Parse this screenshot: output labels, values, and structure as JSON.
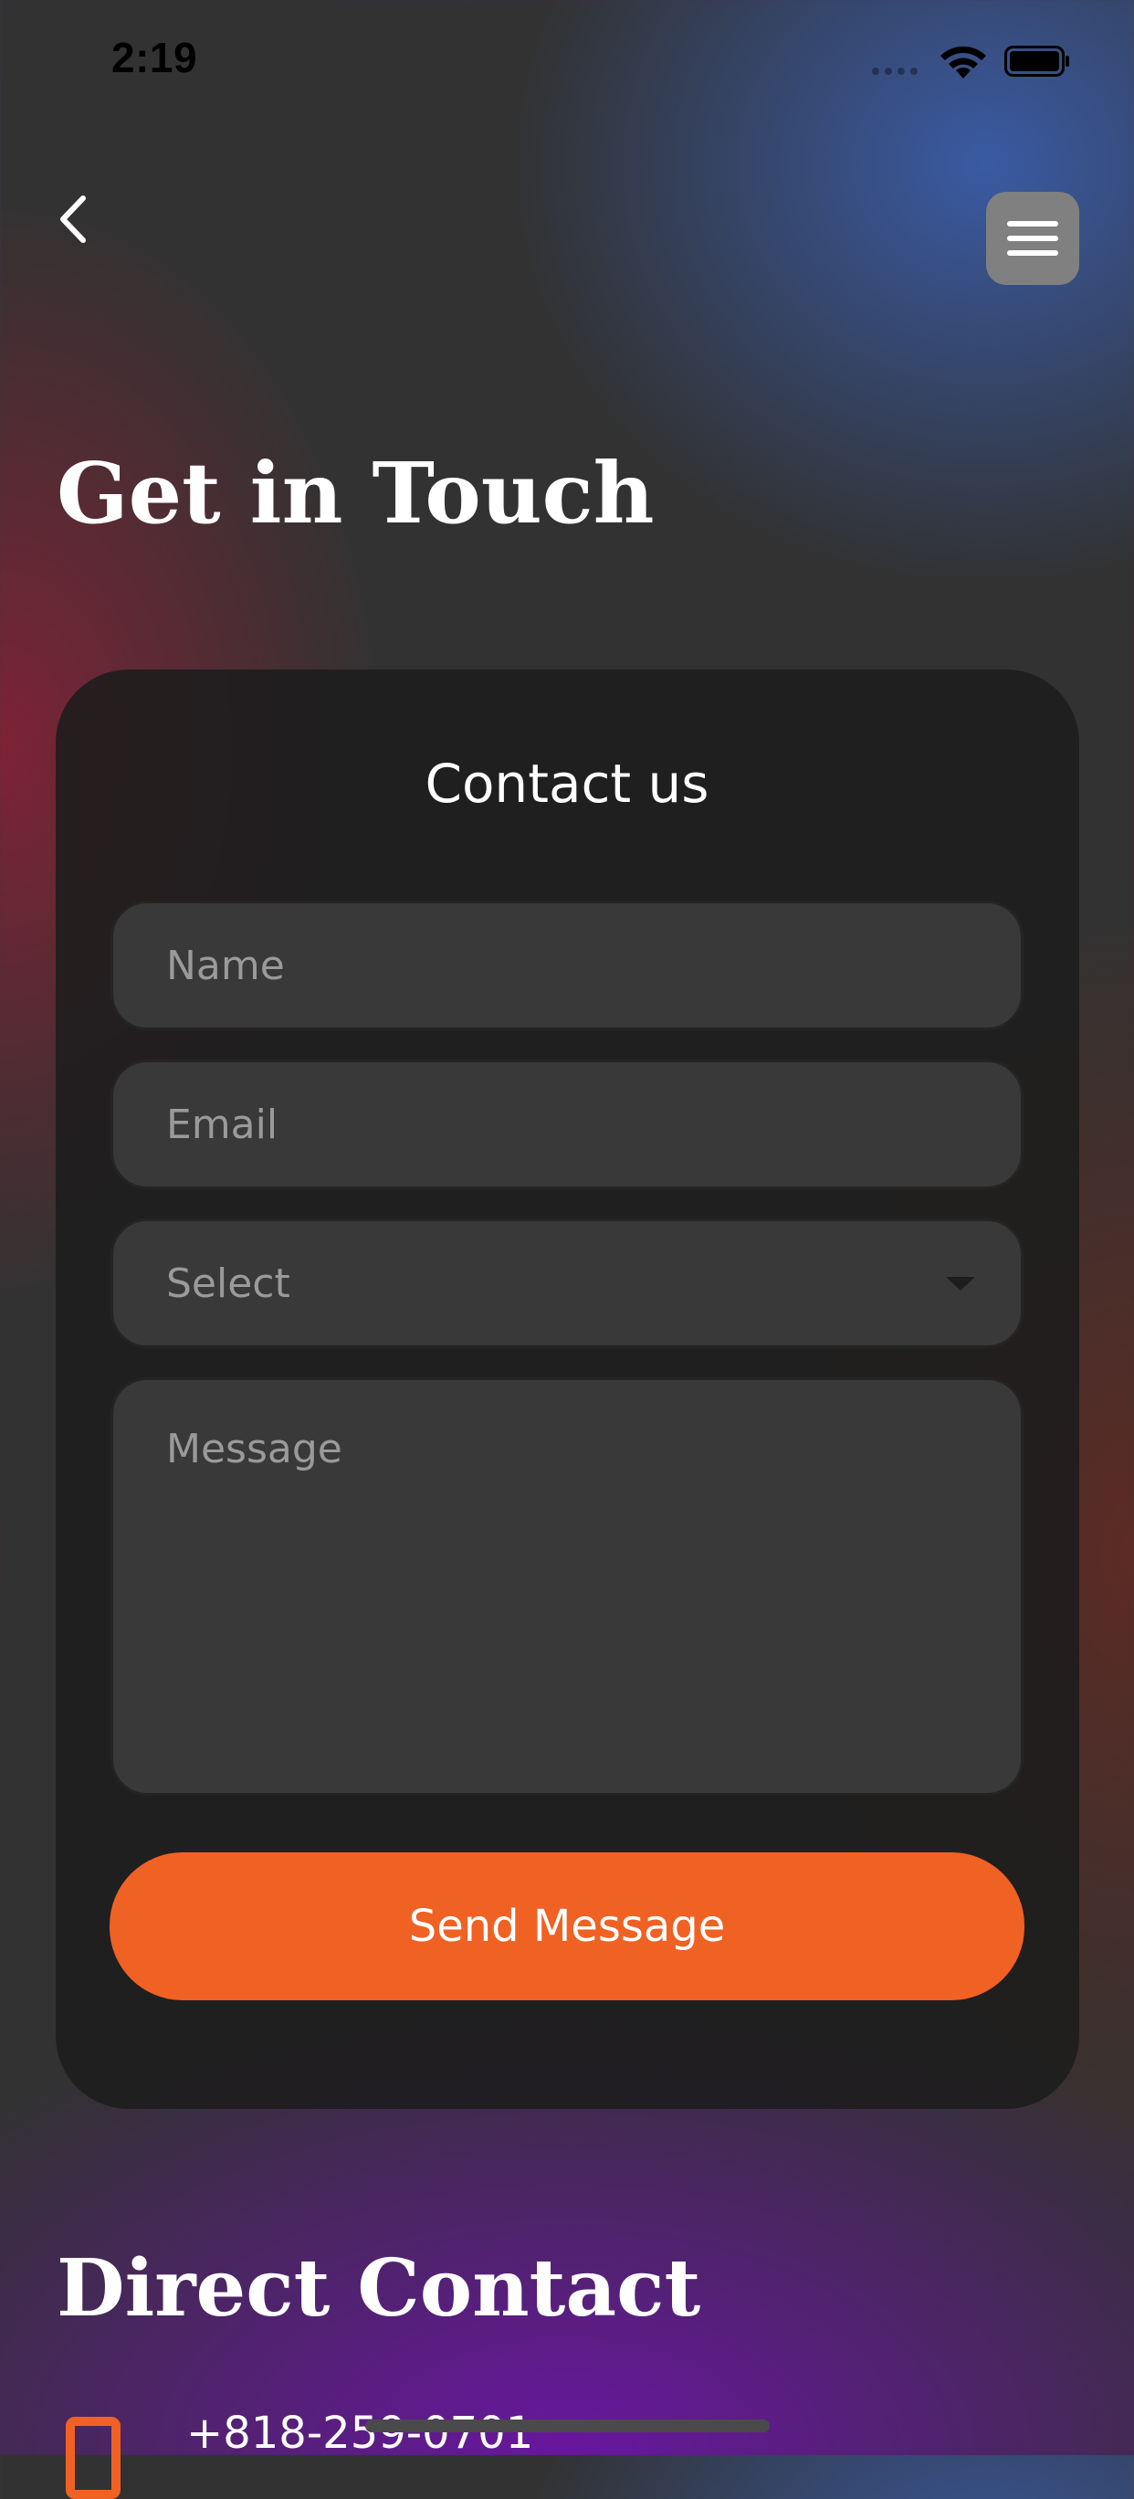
{
  "status_bar": {
    "time": "2:19",
    "icons": [
      "signal-icon",
      "wifi-icon",
      "battery-icon"
    ]
  },
  "nav": {
    "back_icon": "chevron-left-icon",
    "menu_icon": "hamburger-menu-icon"
  },
  "page": {
    "title": "Get in Touch"
  },
  "contact_form": {
    "title": "Contact us",
    "name_placeholder": "Name",
    "email_placeholder": "Email",
    "select_value": "Select",
    "message_placeholder": "Message",
    "submit_label": "Send Message"
  },
  "direct_contact": {
    "title": "Direct Contact",
    "phone": "+818-259-0701",
    "phone_icon": "phone-icon"
  },
  "colors": {
    "accent": "#f06124",
    "card_background": "#1c1c1c",
    "field_background": "#393939",
    "menu_button": "#808080"
  }
}
